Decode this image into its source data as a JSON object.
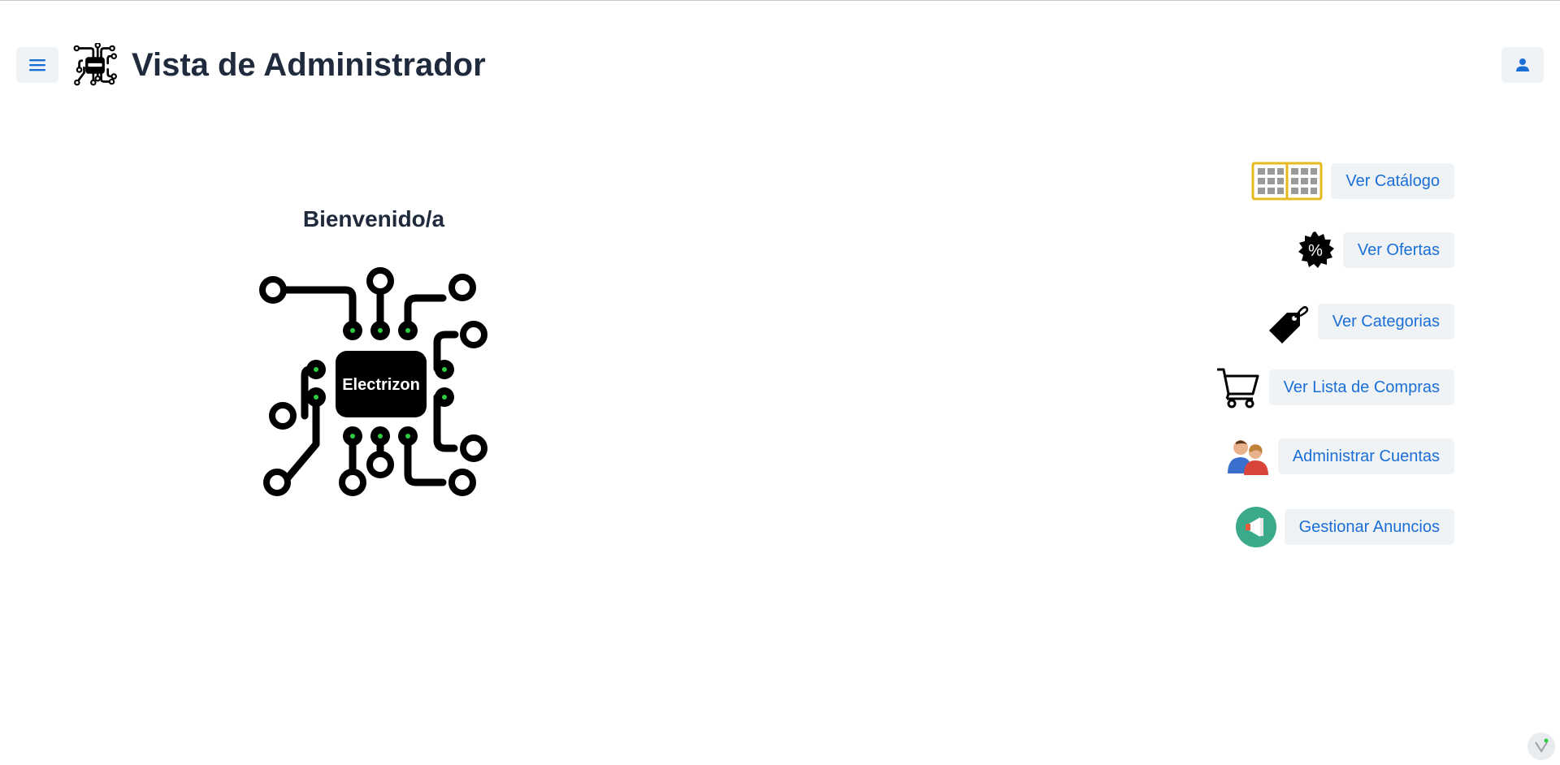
{
  "header": {
    "title": "Vista de Administrador",
    "menu_icon": "hamburger-menu-icon",
    "user_icon": "user-icon",
    "logo_icon": "circuit-chip-icon"
  },
  "main": {
    "welcome": "Bienvenido/a",
    "logo_text": "Electrizon"
  },
  "nav": {
    "items": [
      {
        "label": "Ver Catálogo",
        "icon": "catalog-book-icon"
      },
      {
        "label": "Ver Ofertas",
        "icon": "percent-badge-icon"
      },
      {
        "label": "Ver Categorias",
        "icon": "price-tag-icon"
      },
      {
        "label": "Ver Lista de Compras",
        "icon": "shopping-cart-icon"
      },
      {
        "label": "Administrar Cuentas",
        "icon": "users-icon"
      },
      {
        "label": "Gestionar Anuncios",
        "icon": "megaphone-icon"
      }
    ]
  },
  "colors": {
    "accent": "#1a6fd6",
    "button_bg": "#f0f3f6",
    "title": "#1f2a3c"
  }
}
